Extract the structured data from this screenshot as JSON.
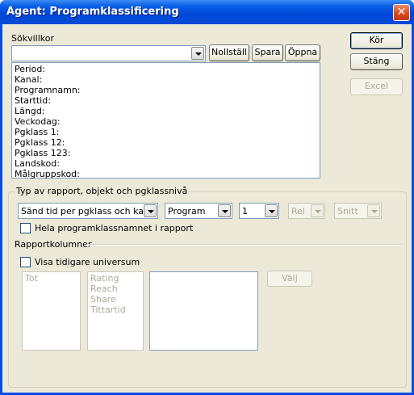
{
  "window": {
    "title": "Agent: Programklassificering",
    "close_glyph": "✕"
  },
  "search": {
    "label": "Sökvillkor",
    "combo_value": "",
    "reset_label": "Nollställ",
    "save_label": "Spara",
    "open_label": "Öppna",
    "conditions": [
      "Period:",
      "Kanal:",
      "Programnamn:",
      "Starttid:",
      "Längd:",
      "Veckodag:",
      "Pgklass 1:",
      "Pgklass 12:",
      "Pgklass 123:",
      "Landskod:",
      "Målgruppskod:"
    ]
  },
  "side_buttons": {
    "run_label": "Kör",
    "close_label": "Stäng",
    "excel_label": "Excel"
  },
  "report_type": {
    "group_label": "Typ av rapport, objekt och pgklassnivå",
    "report_value": "Sänd tid per pgklass och kanal",
    "object_value": "Program",
    "level_value": "1",
    "rel_value": "Rel",
    "avg_value": "Snitt",
    "full_name_checkbox_label": "Hela programklassnamnet  i rapport",
    "full_name_checked": false
  },
  "report_columns": {
    "group_label": "Rapportkolumner",
    "show_previous_label": "Visa tidigare universum",
    "show_previous_checked": false,
    "universe_list": [
      "Tot"
    ],
    "measures_list": [
      "Rating",
      "Reach",
      "Share",
      "Tittartid"
    ],
    "selected_list": [],
    "choose_label": "Välj"
  }
}
